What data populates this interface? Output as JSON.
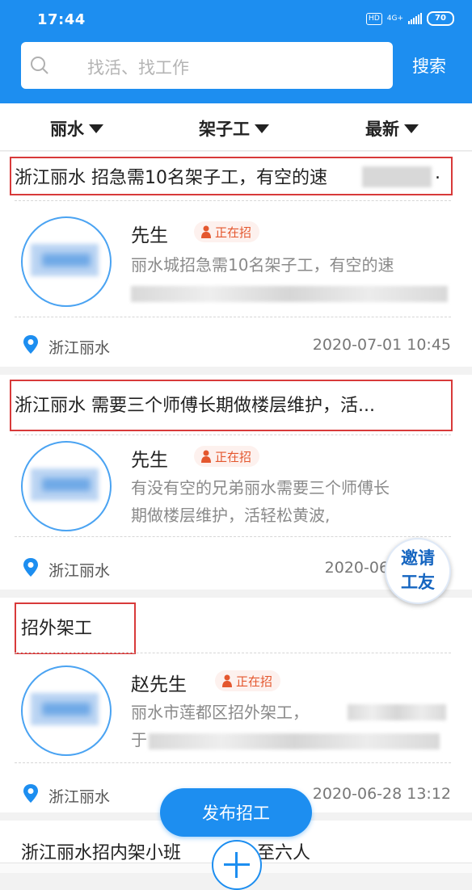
{
  "status_bar": {
    "time": "17:44",
    "hd": "HD",
    "network": "4G+",
    "battery": "70"
  },
  "search": {
    "placeholder": "找活、找工作",
    "button_label": "搜索"
  },
  "filters": [
    {
      "label": "丽水"
    },
    {
      "label": "架子工"
    },
    {
      "label": "最新"
    }
  ],
  "jobs": [
    {
      "title": "浙江丽水 招急需10名架子工，有空的速",
      "title_suffix": ".",
      "poster_name": "先生",
      "status": "正在招",
      "desc_line1": "丽水城招急需10名架子工，有空的速",
      "location": "浙江丽水",
      "datetime": "2020-07-01 10:45"
    },
    {
      "title": "浙江丽水 需要三个师傅长期做楼层维护，活...",
      "poster_name": "先生",
      "status": "正在招",
      "desc_line1": "有没有空的兄弟丽水需要三个师傅长",
      "desc_line2": "期做楼层维护，活轻松黄波,",
      "location": "浙江丽水",
      "datetime": "2020-06-2"
    },
    {
      "title": "招外架工",
      "poster_name": "赵先生",
      "status": "正在招",
      "desc_line1": "丽水市莲都区招外架工，",
      "desc_line2_start": "于",
      "location": "浙江丽水",
      "datetime": "2020-06-28 13:12"
    },
    {
      "title": "浙江丽水招内架小班",
      "title_tail": "至六人"
    }
  ],
  "invite_badge": {
    "line1": "邀请",
    "line2": "工友"
  },
  "post_job_label": "发布招工",
  "colors": {
    "primary": "#1d8ef0",
    "highlight": "#d83a3a",
    "status": "#e4572e"
  }
}
